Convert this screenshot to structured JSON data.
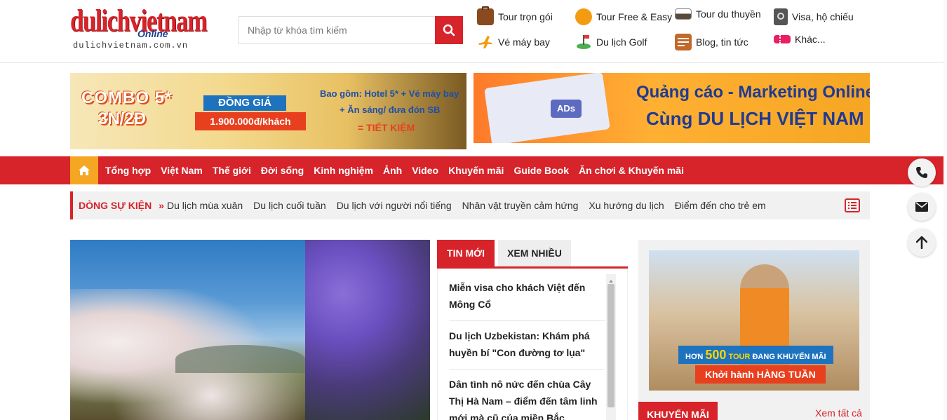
{
  "header": {
    "logo_main": "dulichvietnam",
    "logo_online": "Online",
    "logo_sub": "dulichvietnam.com.vn",
    "search_placeholder": "Nhập từ khóa tìm kiếm",
    "quicklinks": [
      {
        "label": "Tour trọn gói",
        "icon": "suitcase-icon"
      },
      {
        "label": "Tour Free & Easy",
        "icon": "free-easy-icon"
      },
      {
        "label": "Tour du thuyền",
        "icon": "cruise-ship-icon"
      },
      {
        "label": "Visa, hộ chiếu",
        "icon": "passport-icon"
      },
      {
        "label": "Vé máy bay",
        "icon": "airplane-icon"
      },
      {
        "label": "Du lịch Golf",
        "icon": "golf-icon"
      },
      {
        "label": "Blog, tin tức",
        "icon": "blog-icon"
      },
      {
        "label": "Khác...",
        "icon": "ticket-icon"
      }
    ]
  },
  "banners": {
    "left": {
      "combo": "COMBO 5*",
      "duration": "3N/2Đ",
      "same_price": "ĐỒNG GIÁ",
      "price": "1.900.000đ/khách",
      "includes_1": "Bao gồm: Hotel 5* + Vé máy bay",
      "includes_2": "+ Ăn sáng/ đưa đón SB",
      "saving": "= TIẾT KIỆM"
    },
    "right": {
      "line1": "Quảng cáo - Marketing Online",
      "line2": "Cùng DU LỊCH VIỆT NAM",
      "badge": "ADs"
    }
  },
  "nav": {
    "items": [
      "Tổng hợp",
      "Việt Nam",
      "Thế giới",
      "Đời sống",
      "Kinh nghiệm",
      "Ảnh",
      "Video",
      "Khuyến mãi",
      "Guide Book",
      "Ăn chơi & Khuyến mãi"
    ]
  },
  "events": {
    "title": "DÒNG SỰ KIỆN",
    "items": [
      "Du lịch mùa xuân",
      "Du lịch cuối tuần",
      "Du lịch với người nổi tiếng",
      "Nhân vật truyền cảm hứng",
      "Xu hướng du lịch",
      "Điểm đến cho trẻ em"
    ]
  },
  "tabs": {
    "active": "TIN MỚI",
    "inactive": "XEM NHIỀU"
  },
  "news": [
    "Miễn visa cho khách Việt đến Mông Cổ",
    "Du lịch Uzbekistan: Khám phá huyền bí \"Con đường tơ lụa\"",
    "Dân tình nô nức đến chùa Cây Thị Hà Nam – điểm đến tâm linh mới mà cũ của miền Bắc"
  ],
  "sidebar": {
    "ad_line1_pre": "HƠN",
    "ad_line1_num": "500",
    "ad_line1_tour": "TOUR",
    "ad_line1_post": "ĐANG KHUYẾN MÃI",
    "ad_line2": "Khởi hành HÀNG TUẦN",
    "section_title": "KHUYẾN MÃI",
    "see_all": "Xem tất cả"
  },
  "colors": {
    "brand_red": "#d7232a",
    "accent_orange": "#f5a623"
  }
}
